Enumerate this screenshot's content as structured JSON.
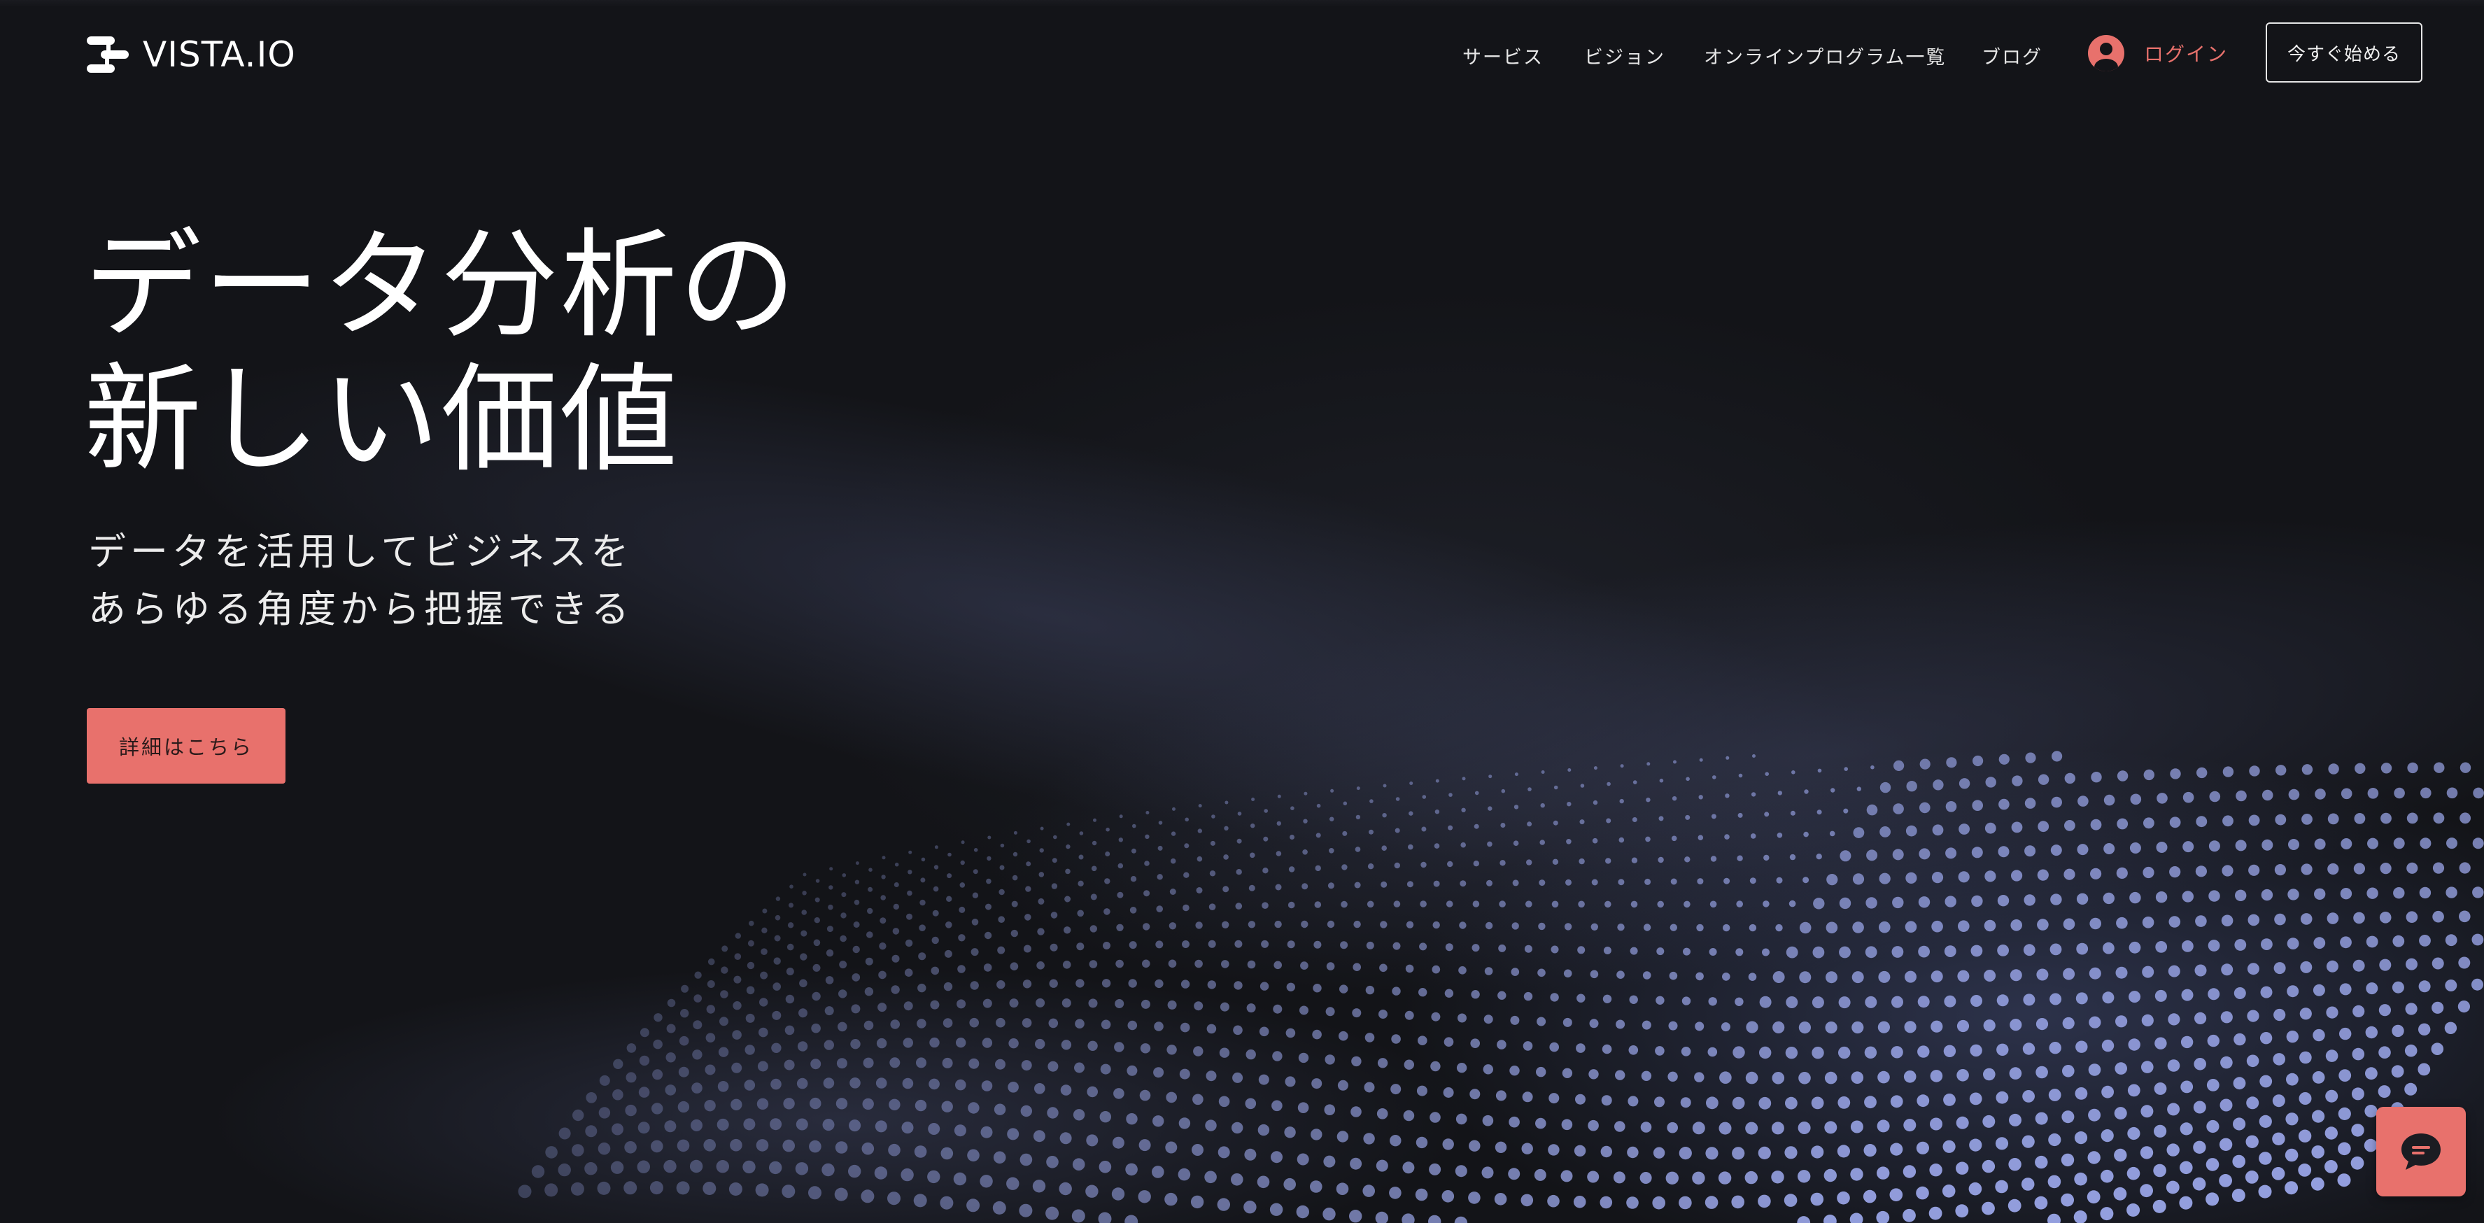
{
  "brand": {
    "name": "VISTA.IO",
    "logo_icon": "vista-logo-icon"
  },
  "nav": {
    "items": [
      {
        "label": "サービス"
      },
      {
        "label": "ビジョン"
      },
      {
        "label": "オンラインプログラム一覧"
      },
      {
        "label": "ブログ"
      }
    ],
    "login_label": "ログイン",
    "login_icon": "user-avatar-icon",
    "start_label": "今すぐ始める"
  },
  "hero": {
    "headline_line1": "データ分析の",
    "headline_line2": "新しい価値",
    "subhead_line1": "データを活用してビジネスを",
    "subhead_line2": "あらゆる角度から把握できる",
    "cta_label": "詳細はこちら"
  },
  "chat": {
    "icon": "chat-bubble-icon"
  },
  "colors": {
    "background": "#131418",
    "accent": "#e8716c",
    "particles": "#a9b6ff",
    "text": "#ffffff"
  }
}
